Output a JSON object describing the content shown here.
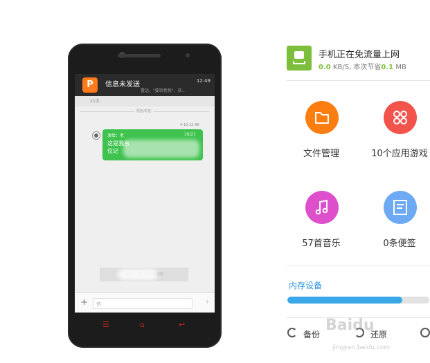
{
  "phone": {
    "notification": {
      "app_icon_letter": "P",
      "title": "信息未发送",
      "time": "12:49",
      "snippet": "置话，\"要审我我\"，获..."
    },
    "thread_partial": "21次",
    "separator_label": "短信/彩信",
    "message": {
      "timestamp": "4-13 12:48",
      "from_label": "发给：老",
      "count": "16/21",
      "body_line1": "这是我台",
      "body_line2": "位记"
    },
    "bottom_button": "重发(…)  重发的短信消息",
    "input_placeholder": "信",
    "plus_symbol": "+",
    "send_symbol": "›",
    "nav_keys": [
      "☰",
      "⌂",
      "↩"
    ]
  },
  "status": {
    "title": "手机正在免流量上网",
    "speed_value": "0.0",
    "speed_unit": "KB/S, 本次节省",
    "saved_value": "0.1",
    "saved_unit": "MB",
    "icon": "phone-sync-icon",
    "accent": "#7dbf3c"
  },
  "tiles": [
    {
      "label": "文件管理",
      "color": "#fd7e10",
      "icon": "folder-icon"
    },
    {
      "label": "10个应用游戏",
      "color": "#f2534a",
      "icon": "apps-grid-icon"
    },
    {
      "label": "57首音乐",
      "color": "#dd4fcb",
      "icon": "music-note-icon"
    },
    {
      "label": "0条便签",
      "color": "#6ea9f3",
      "icon": "note-icon"
    }
  ],
  "storage": {
    "title": "内存设备",
    "used_fraction": 0.81,
    "bar_color": "#3aa8e6"
  },
  "bottom_actions": [
    {
      "label": "备份",
      "icon": "backup-icon"
    },
    {
      "label": "还原",
      "icon": "restore-icon"
    }
  ],
  "watermark": {
    "text": "Baidu",
    "sub": "jingyan.baidu.com"
  }
}
